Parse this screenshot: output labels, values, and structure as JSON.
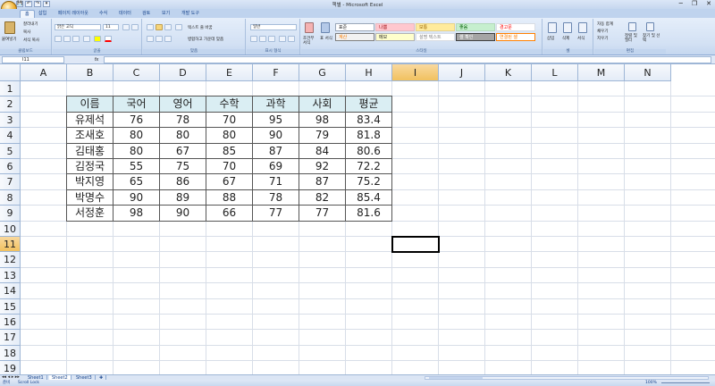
{
  "window": {
    "title": "책별 - Microsoft Excel",
    "controls": [
      "─",
      "❐",
      "✕"
    ]
  },
  "quick_access": [
    "💾",
    "↶",
    "↷",
    "▾"
  ],
  "tabs": [
    "홈",
    "삽입",
    "페이지 레이아웃",
    "수식",
    "데이터",
    "검토",
    "보기",
    "개발 도구"
  ],
  "ribbon": {
    "clipboard": {
      "label": "클립보드",
      "paste": "붙여넣기",
      "cut": "잘라내기",
      "copy": "복사",
      "format_painter": "서식 복사"
    },
    "font": {
      "label": "글꼴",
      "name": "맑은 고딕",
      "size": "11"
    },
    "alignment": {
      "label": "맞춤",
      "wrap": "텍스트 줄 바꿈",
      "merge": "병합하고 가운데 맞춤"
    },
    "number": {
      "label": "표시 형식",
      "format": "일반"
    },
    "styles": {
      "label": "스타일",
      "conditional": "조건부 서식",
      "table": "표 서식",
      "items": [
        {
          "label": "표준",
          "bg": "#ffffff",
          "fg": "#222222",
          "border": "#9aa7b8"
        },
        {
          "label": "나쁨",
          "bg": "#ffc7ce",
          "fg": "#9c0006",
          "border": "#e7b9bf"
        },
        {
          "label": "보통",
          "bg": "#ffeb9c",
          "fg": "#9c6500",
          "border": "#e8d48b"
        },
        {
          "label": "좋음",
          "bg": "#c6efce",
          "fg": "#006100",
          "border": "#b3d9ba"
        },
        {
          "label": "경고문",
          "bg": "#ffffff",
          "fg": "#ff0000",
          "border": "#d9dde4"
        },
        {
          "label": "계산",
          "bg": "#f2f2f2",
          "fg": "#fa7d00",
          "border": "#7f7f7f"
        },
        {
          "label": "메모",
          "bg": "#ffffcc",
          "fg": "#222222",
          "border": "#b2b2b2"
        },
        {
          "label": "설명 텍스트",
          "bg": "#ffffff",
          "fg": "#7f7f7f",
          "border": "#d9dde4"
        },
        {
          "label": "셀 확인",
          "bg": "#a5a5a5",
          "fg": "#ffffff",
          "border": "#3f3f3f"
        },
        {
          "label": "연결된 셀",
          "bg": "#ffffff",
          "fg": "#fa7d00",
          "border": "#ff8001"
        }
      ]
    },
    "cells": {
      "label": "셀",
      "insert": "삽입",
      "delete": "삭제",
      "format": "서식"
    },
    "editing": {
      "label": "편집",
      "autosum": "자동 합계",
      "fill": "채우기",
      "clear": "지우기",
      "sort": "정렬 및 필터",
      "find": "찾기 및 선택"
    }
  },
  "formula_bar": {
    "name_box": "I11",
    "fx": "fx",
    "content": ""
  },
  "sheet": {
    "columns": [
      "A",
      "B",
      "C",
      "D",
      "E",
      "F",
      "G",
      "H",
      "I",
      "J",
      "K",
      "L",
      "M",
      "N"
    ],
    "rows": [
      "1",
      "2",
      "3",
      "4",
      "5",
      "6",
      "7",
      "8",
      "9",
      "10",
      "11",
      "12",
      "13",
      "14",
      "15",
      "16",
      "17",
      "18",
      "19"
    ],
    "selected_col": "I",
    "selected_row": "11",
    "table": {
      "headers": [
        "이름",
        "국어",
        "영어",
        "수학",
        "과학",
        "사회",
        "평균"
      ],
      "header_bg": "#daeef3",
      "rows": [
        [
          "유제석",
          "76",
          "78",
          "70",
          "95",
          "98",
          "83.4"
        ],
        [
          "조새호",
          "80",
          "80",
          "80",
          "90",
          "79",
          "81.8"
        ],
        [
          "김태홍",
          "80",
          "67",
          "85",
          "87",
          "84",
          "80.6"
        ],
        [
          "김정국",
          "55",
          "75",
          "70",
          "69",
          "92",
          "72.2"
        ],
        [
          "박지영",
          "65",
          "86",
          "67",
          "71",
          "87",
          "75.2"
        ],
        [
          "박명수",
          "90",
          "89",
          "88",
          "78",
          "82",
          "85.4"
        ],
        [
          "서정훈",
          "98",
          "90",
          "66",
          "77",
          "77",
          "81.6"
        ]
      ]
    }
  },
  "sheet_tabs": [
    "Sheet1",
    "Sheet2",
    "Sheet3"
  ],
  "active_sheet": "Sheet2",
  "status": {
    "mode": "준비",
    "scroll_lock": "Scroll Lock",
    "zoom": "100%"
  }
}
